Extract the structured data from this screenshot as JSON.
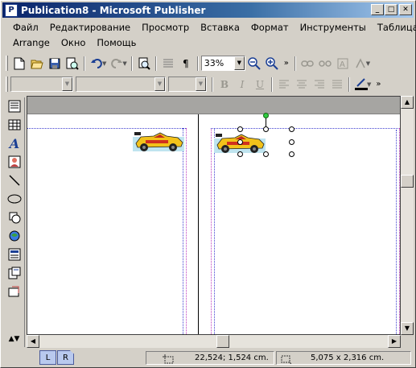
{
  "window": {
    "title": "Publication8 - Microsoft Publisher",
    "icon_name": "publisher-app-icon",
    "controls": [
      "minimize",
      "maximize",
      "close"
    ]
  },
  "menu": {
    "row1": [
      "Файл",
      "Редактирование",
      "Просмотр",
      "Вставка",
      "Формат",
      "Инструменты",
      "Таблица"
    ],
    "row2": [
      "Arrange",
      "Окно",
      "Помощь"
    ]
  },
  "standard_toolbar": {
    "icons": [
      "new-icon",
      "open-icon",
      "save-icon",
      "print-preview-icon",
      "undo-icon",
      "redo-icon",
      "zoom-preview-icon",
      "columns-icon",
      "pilcrow-icon",
      "zoom-out-icon",
      "zoom-in-icon",
      "link-icon",
      "unlink-icon",
      "text-wrap-icon",
      "format-icon"
    ],
    "zoom_value": "33%"
  },
  "format_toolbar": {
    "style_value": "",
    "font_value": "",
    "size_value": "",
    "bold": "B",
    "italic": "I",
    "underline": "U"
  },
  "tools_palette": [
    "text-box-tool",
    "table-tool",
    "wordart-tool",
    "picture-tool",
    "line-tool",
    "oval-tool",
    "autoshapes-tool",
    "clip-tool",
    "hot-spot-tool",
    "form-tool",
    "design-gallery-tool"
  ],
  "document": {
    "ruler_color": "#a6a5a2",
    "pages": [
      "L",
      "R"
    ],
    "images": [
      {
        "name": "race-car-clipart-left"
      },
      {
        "name": "race-car-clipart-right",
        "selected": true
      }
    ]
  },
  "status": {
    "page_tabs": [
      "L",
      "R"
    ],
    "position": "22,524; 1,524 cm.",
    "size": "5,075 x   2,316 cm."
  },
  "colors": {
    "titlebar_start": "#0a246a",
    "titlebar_end": "#a6caf0",
    "face": "#d4d0c8",
    "guides": "#4040d0"
  }
}
